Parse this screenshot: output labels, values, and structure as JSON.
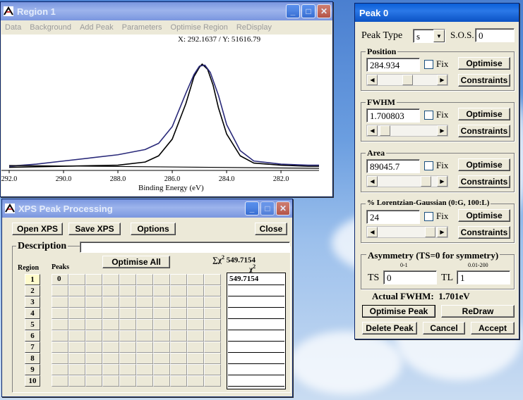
{
  "region_window": {
    "title": "Region 1",
    "menu": [
      "Data",
      "Background",
      "Add Peak",
      "Parameters",
      "Optimise Region",
      "ReDisplay"
    ],
    "cursor_readout": "X: 292.1637 / Y: 51616.79",
    "plot": {
      "x_ticks": [
        "292.0",
        "290.0",
        "288.0",
        "286.0",
        "284.0",
        "282.0"
      ],
      "x_label": "Binding Energy (eV)"
    }
  },
  "chart_data": {
    "type": "line",
    "xlabel": "Binding Energy (eV)",
    "xlim": [
      292,
      280.6
    ],
    "x_reversed": true,
    "series": [
      {
        "color": "#000000",
        "x": [
          292,
          290,
          288,
          287,
          286.5,
          286,
          285.5,
          285.2,
          285,
          284.9,
          284.7,
          284.5,
          284.3,
          284,
          283.5,
          283,
          282,
          281,
          280.6
        ],
        "y": [
          0.01,
          0.02,
          0.03,
          0.06,
          0.12,
          0.28,
          0.62,
          0.88,
          0.97,
          1.0,
          0.95,
          0.8,
          0.58,
          0.33,
          0.12,
          0.05,
          0.03,
          0.02,
          0.02
        ]
      },
      {
        "color": "#2a2a7a",
        "x": [
          292,
          291,
          290,
          289,
          288,
          287,
          286.5,
          286,
          285.5,
          285.2,
          285,
          284.8,
          284.6,
          284.3,
          284,
          283.5,
          283,
          282,
          281,
          280.6
        ],
        "y": [
          0.02,
          0.04,
          0.07,
          0.1,
          0.13,
          0.18,
          0.24,
          0.4,
          0.72,
          0.9,
          0.98,
          0.99,
          0.92,
          0.7,
          0.42,
          0.17,
          0.07,
          0.04,
          0.03,
          0.03
        ]
      }
    ]
  },
  "xps_window": {
    "title": "XPS Peak Processing",
    "buttons": {
      "open": "Open XPS",
      "save": "Save XPS",
      "options": "Options",
      "close": "Close",
      "optimise_all": "Optimise All"
    },
    "description_label": "Description",
    "region_header": "Region",
    "peaks_header": "Peaks",
    "peak_zero": "0",
    "sum_label": "∑χ",
    "sum_exp": "2",
    "sum_value": "549.7154",
    "chi_label": "χ",
    "chi_exp": "2",
    "regions": [
      "1",
      "2",
      "3",
      "4",
      "5",
      "6",
      "7",
      "8",
      "9",
      "10"
    ],
    "chi_values": [
      "549.7154",
      "",
      "",
      "",
      "",
      "",
      "",
      "",
      "",
      ""
    ]
  },
  "peak_window": {
    "title": "Peak 0",
    "peak_type_label": "Peak Type",
    "peak_type_value": "s",
    "sos_label": "S.O.S.",
    "sos_value": "0",
    "fix_label": "Fix",
    "optimise_label": "Optimise",
    "constraints_label": "Constraints",
    "params": [
      {
        "title": "Position",
        "value": "284.934"
      },
      {
        "title": "FWHM",
        "value": "1.700803"
      },
      {
        "title": "Area",
        "value": "89045.7"
      },
      {
        "title": "% Lorentzian-Gaussian (0:G, 100:L)",
        "value": "24"
      }
    ],
    "asymmetry_title": "Asymmetry (TS=0 for symmetry)",
    "ts_range": "0-1",
    "tl_range": "0.01-200",
    "ts_label": "TS",
    "ts_value": "0",
    "tl_label": "TL",
    "tl_value": "1",
    "actual_fwhm": "Actual FWHM:  1.701eV",
    "buttons": {
      "optimise_peak": "Optimise Peak",
      "redraw": "ReDraw",
      "delete_peak": "Delete Peak",
      "cancel": "Cancel",
      "accept": "Accept"
    }
  }
}
